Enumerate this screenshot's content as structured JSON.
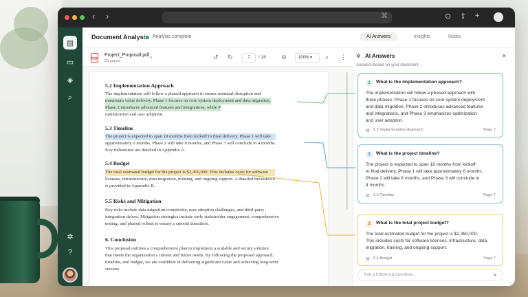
{
  "browser": {
    "address_icon": "reader-icon",
    "toolbar_icons": [
      "download-icon",
      "share-icon",
      "plus-icon",
      "sidebar-icon"
    ]
  },
  "rail": {
    "items": [
      {
        "icon": "document-icon",
        "active": true
      },
      {
        "icon": "chat-icon",
        "active": false
      },
      {
        "icon": "layers-icon",
        "active": false
      },
      {
        "icon": "search-icon",
        "active": false
      }
    ],
    "bottom": [
      "settings-icon",
      "help-icon"
    ]
  },
  "header": {
    "title": "Document Analysis",
    "status": "Analysis complete",
    "status_color": "#3aa86a",
    "tabs": [
      {
        "label": "AI Answers",
        "active": true
      },
      {
        "label": "Insights",
        "active": false
      },
      {
        "label": "Notes",
        "active": false
      }
    ]
  },
  "doc_toolbar": {
    "file_name": "Project_Proposal.pdf",
    "file_pages": "28 pages",
    "current_page": "7",
    "total_pages": "/ 28",
    "zoom": "100%"
  },
  "document": {
    "sections": [
      {
        "heading": "5.2 Implementation Approach",
        "lines": [
          "The implementation will follow a phased approach to ensure minimal disruption and",
          "maximum value delivery. Phase 1 focuses on core system deployment and data migration,",
          "Phase 2 introduces advanced features and integrations, while Phase 3 emphasizes",
          "optimization and user adoption."
        ]
      },
      {
        "heading": "5.3 Timeline",
        "lines": [
          "The project is expected to span 18 months from kickoff to final delivery. Phase 1 will take",
          "approximately 6 months, Phase 2 will take 8 months, and Phase 3 will conclude in 4 months.",
          "Key milestones are detailed in Appendix A."
        ]
      },
      {
        "heading": "5.4 Budget",
        "lines": [
          "The total estimated budget for the project is $2,450,000. This includes costs for software",
          "licenses, infrastructure, data migration, training, and ongoing support. A detailed breakdown",
          "is provided in Appendix B."
        ]
      },
      {
        "heading": "5.5 Risks and Mitigation",
        "lines": [
          "Key risks include data migration complexity, user adoption challenges, and third-party",
          "integration delays. Mitigation strategies include early stakeholder engagement, comprehensive",
          "testing, and phased rollout to ensure a smooth transition."
        ]
      },
      {
        "heading": "6. Conclusion",
        "lines": [
          "This proposal outlines a comprehensive plan to implement a scalable and secure solution",
          "that meets the organization's current and future needs. By following the proposed approach,",
          "timeline, and budget, we are confident in delivering significant value and achieving long-term",
          "success."
        ]
      }
    ]
  },
  "answers": {
    "title": "AI Answers",
    "subtitle": "Answers based on your document",
    "cards": [
      {
        "number": "1",
        "question": "What is the implementation approach?",
        "answer_lines": [
          "The implementation will follow a phased approach with",
          "three phases: Phase 1 focuses on core system deployment",
          "and data migration, Phase 2 introduces advanced features",
          "and integrations, and Phase 3 emphasizes optimization",
          "and user adoption."
        ],
        "source": "5.2 Implementation Approach",
        "page": "Page 7",
        "accent": "#3aa86a"
      },
      {
        "number": "2",
        "question": "What is the project timeline?",
        "answer_lines": [
          "The project is expected to span 18 months from kickoff",
          "to final delivery. Phase 1 will take approximately 6 months,",
          "Phase 2 will take 8 months, and Phase 3 will conclude in",
          "4 months."
        ],
        "source": "5.3 Timeline",
        "page": "Page 7",
        "accent": "#3a8fc4"
      },
      {
        "number": "3",
        "question": "What is the total project budget?",
        "answer_lines": [
          "The total estimated budget for the project is $2,450,000.",
          "This includes costs for software licenses, infrastructure, data",
          "migration, training, and ongoing support."
        ],
        "source": "5.4 Budget",
        "page": "Page 7",
        "accent": "#e0a630"
      }
    ],
    "followup_placeholder": "Ask a follow-up question..."
  }
}
